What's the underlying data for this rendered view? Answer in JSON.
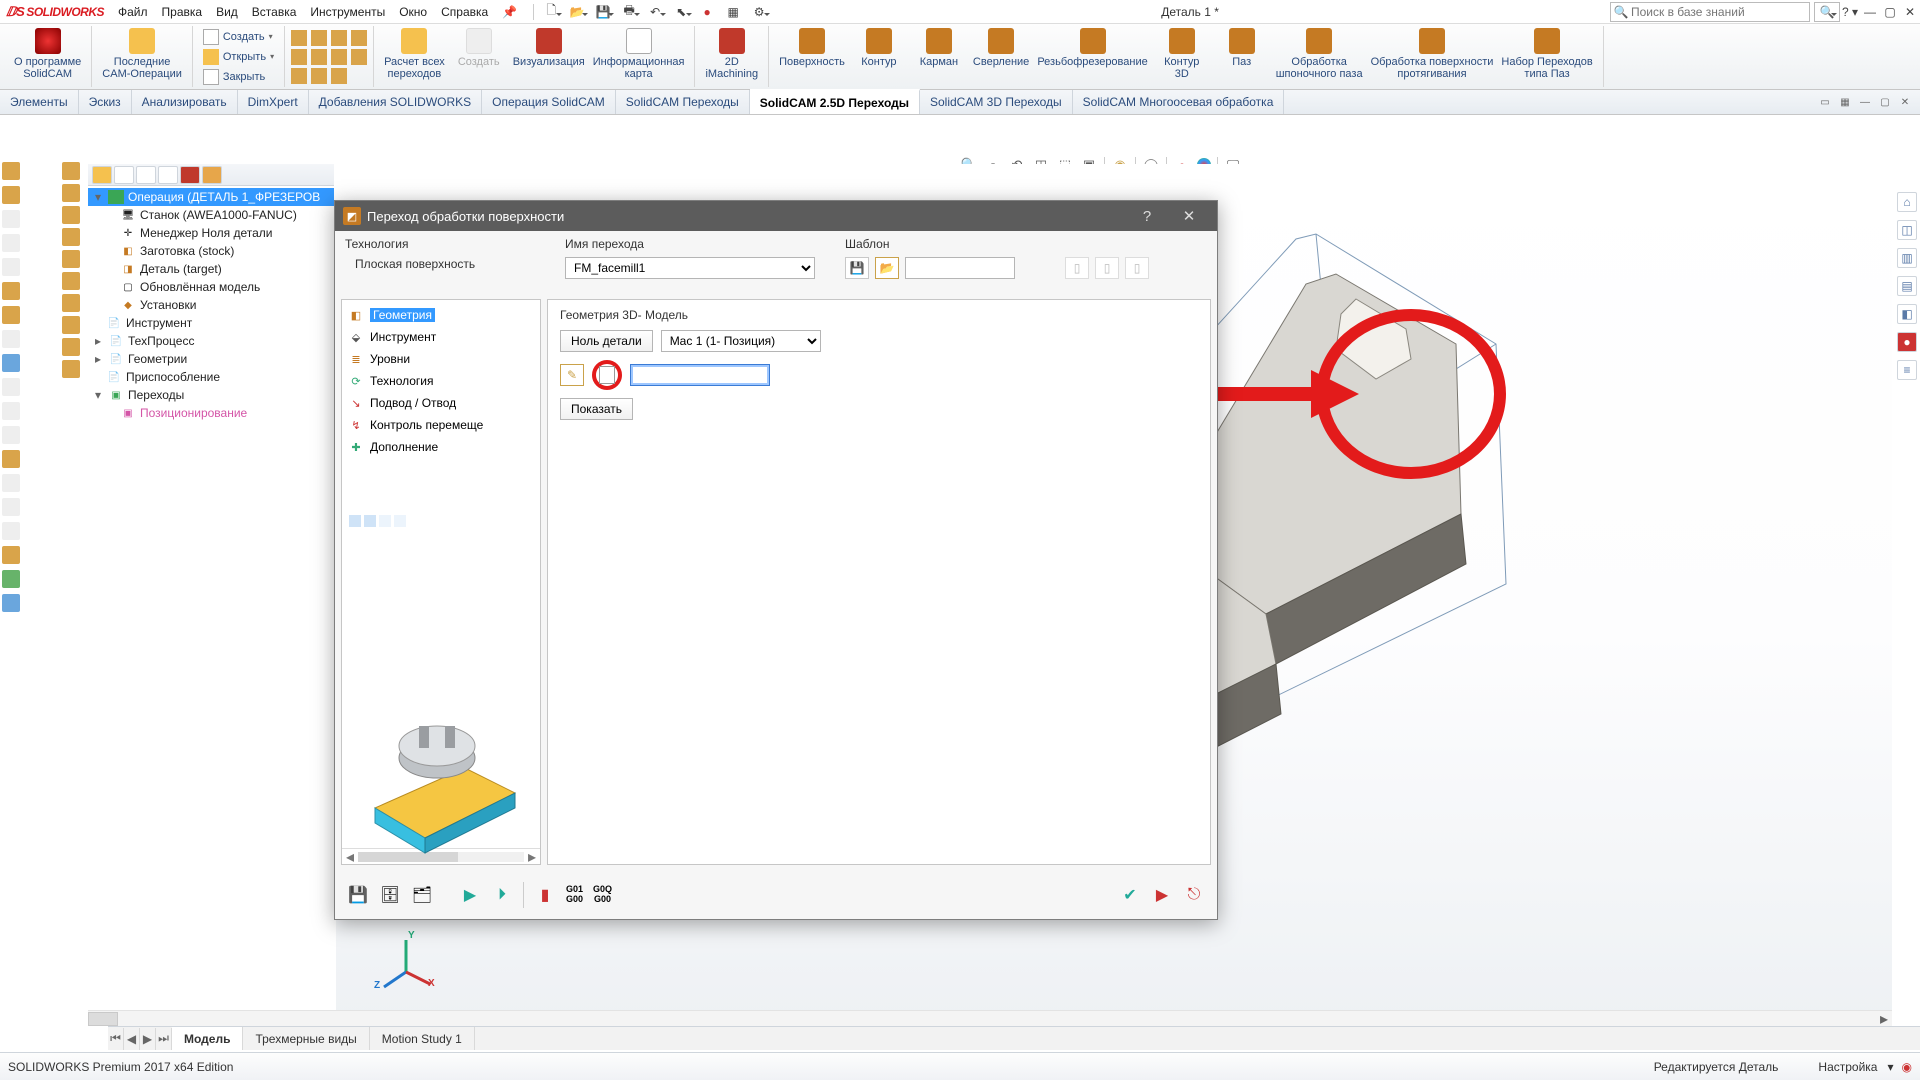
{
  "app": {
    "brand": "SOLIDWORKS",
    "doc_title": "Деталь 1 *",
    "search_placeholder": "Поиск в базе знаний"
  },
  "menu": {
    "file": "Файл",
    "edit": "Правка",
    "view": "Вид",
    "insert": "Вставка",
    "tools": "Инструменты",
    "window": "Окно",
    "help": "Справка"
  },
  "ribbon": {
    "about": {
      "l1": "О программе",
      "l2": "SolidCAM"
    },
    "recent": {
      "l1": "Последние",
      "l2": "CAM-Операции"
    },
    "create": "Создать",
    "open": "Открыть",
    "close": "Закрыть",
    "calc": {
      "l1": "Расчет всех",
      "l2": "переходов"
    },
    "create_btn": "Создать",
    "vis": "Визуализация",
    "info": {
      "l1": "Информационная",
      "l2": "карта"
    },
    "imach": {
      "l1": "2D",
      "l2": "iMachining"
    },
    "surf": "Поверхность",
    "contour": "Контур",
    "pocket": "Карман",
    "drill": "Сверление",
    "thread": "Резьбофрезерование",
    "cont3d": {
      "l1": "Контур",
      "l2": "3D"
    },
    "slot": "Паз",
    "keyway": {
      "l1": "Обработка",
      "l2": "шпоночного паза"
    },
    "surfmach": {
      "l1": "Обработка поверхности",
      "l2": "протягивания"
    },
    "slotset": {
      "l1": "Набор Переходов",
      "l2": "типа Паз"
    }
  },
  "tabs": {
    "elements": "Элементы",
    "sketch": "Эскиз",
    "analyze": "Анализировать",
    "dimxpert": "DimXpert",
    "addins": "Добавления SOLIDWORKS",
    "op_solidcam": "Операция  SolidCAM",
    "sc_trans": "SolidCAM Переходы",
    "sc_25d": "SolidCAM 2.5D Переходы",
    "sc_3d": "SolidCAM 3D Переходы",
    "sc_multi": "SolidCAM Многоосевая обработка"
  },
  "tree": {
    "root": "Операция (ДЕТАЛЬ 1_ФРЕЗЕРОВ",
    "machine": "Станок (AWEA1000-FANUC)",
    "partzero": "Менеджер Ноля детали",
    "stock": "Заготовка (stock)",
    "target": "Деталь (target)",
    "updated": "Обновлённая модель",
    "setups": "Установки",
    "tool": "Инструмент",
    "techproc": "ТехПроцесс",
    "geom": "Геометрии",
    "fixture": "Приспособление",
    "ops": "Переходы",
    "positioning": "Позиционирование"
  },
  "dialog": {
    "title": "Переход обработки поверхности",
    "tech_lbl": "Технология",
    "tech_val": "Плоская поверхность",
    "name_lbl": "Имя перехода",
    "name_val": "FM_facemill1",
    "tmpl_lbl": "Шаблон",
    "nav": {
      "geom": "Геометрия",
      "tool": "Инструмент",
      "levels": "Уровни",
      "tech": "Технология",
      "link": "Подвод / Отвод",
      "motion": "Контроль перемеще",
      "extra": "Дополнение"
    },
    "content": {
      "title": "Геометрия 3D- Модель",
      "zero_btn": "Ноль детали",
      "mac_val": "Mac 1 (1- Позиция)",
      "show_btn": "Показать"
    }
  },
  "btabs": {
    "model": "Модель",
    "views": "Трехмерные виды",
    "motion": "Motion Study 1"
  },
  "status": {
    "left": "SOLIDWORKS Premium 2017 x64 Edition",
    "mode": "Редактируется Деталь",
    "custom": "Настройка"
  },
  "gcode": {
    "a": "G01",
    "b": "G00",
    "c": "G0Q",
    "d": "G00"
  }
}
